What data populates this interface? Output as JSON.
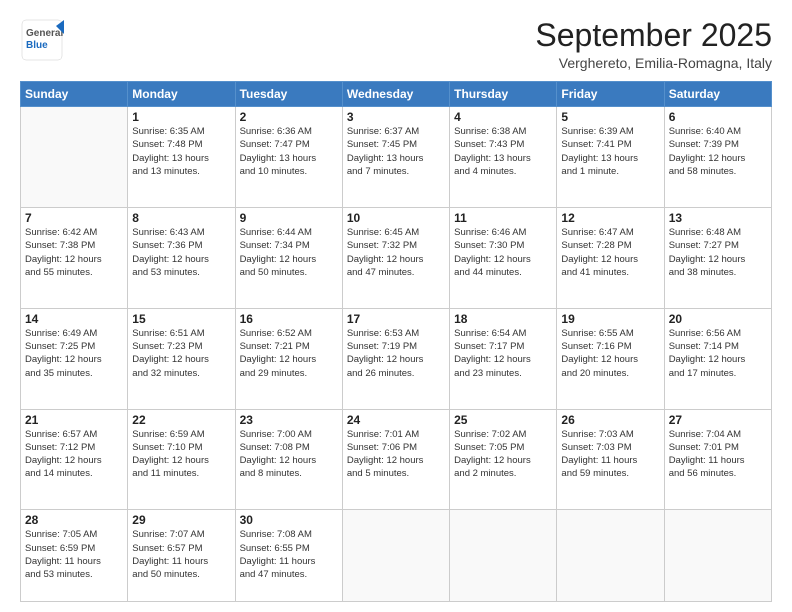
{
  "header": {
    "logo_general": "General",
    "logo_blue": "Blue",
    "month_title": "September 2025",
    "location": "Verghereto, Emilia-Romagna, Italy"
  },
  "weekdays": [
    "Sunday",
    "Monday",
    "Tuesday",
    "Wednesday",
    "Thursday",
    "Friday",
    "Saturday"
  ],
  "weeks": [
    [
      {
        "day": "",
        "text": ""
      },
      {
        "day": "1",
        "text": "Sunrise: 6:35 AM\nSunset: 7:48 PM\nDaylight: 13 hours\nand 13 minutes."
      },
      {
        "day": "2",
        "text": "Sunrise: 6:36 AM\nSunset: 7:47 PM\nDaylight: 13 hours\nand 10 minutes."
      },
      {
        "day": "3",
        "text": "Sunrise: 6:37 AM\nSunset: 7:45 PM\nDaylight: 13 hours\nand 7 minutes."
      },
      {
        "day": "4",
        "text": "Sunrise: 6:38 AM\nSunset: 7:43 PM\nDaylight: 13 hours\nand 4 minutes."
      },
      {
        "day": "5",
        "text": "Sunrise: 6:39 AM\nSunset: 7:41 PM\nDaylight: 13 hours\nand 1 minute."
      },
      {
        "day": "6",
        "text": "Sunrise: 6:40 AM\nSunset: 7:39 PM\nDaylight: 12 hours\nand 58 minutes."
      }
    ],
    [
      {
        "day": "7",
        "text": "Sunrise: 6:42 AM\nSunset: 7:38 PM\nDaylight: 12 hours\nand 55 minutes."
      },
      {
        "day": "8",
        "text": "Sunrise: 6:43 AM\nSunset: 7:36 PM\nDaylight: 12 hours\nand 53 minutes."
      },
      {
        "day": "9",
        "text": "Sunrise: 6:44 AM\nSunset: 7:34 PM\nDaylight: 12 hours\nand 50 minutes."
      },
      {
        "day": "10",
        "text": "Sunrise: 6:45 AM\nSunset: 7:32 PM\nDaylight: 12 hours\nand 47 minutes."
      },
      {
        "day": "11",
        "text": "Sunrise: 6:46 AM\nSunset: 7:30 PM\nDaylight: 12 hours\nand 44 minutes."
      },
      {
        "day": "12",
        "text": "Sunrise: 6:47 AM\nSunset: 7:28 PM\nDaylight: 12 hours\nand 41 minutes."
      },
      {
        "day": "13",
        "text": "Sunrise: 6:48 AM\nSunset: 7:27 PM\nDaylight: 12 hours\nand 38 minutes."
      }
    ],
    [
      {
        "day": "14",
        "text": "Sunrise: 6:49 AM\nSunset: 7:25 PM\nDaylight: 12 hours\nand 35 minutes."
      },
      {
        "day": "15",
        "text": "Sunrise: 6:51 AM\nSunset: 7:23 PM\nDaylight: 12 hours\nand 32 minutes."
      },
      {
        "day": "16",
        "text": "Sunrise: 6:52 AM\nSunset: 7:21 PM\nDaylight: 12 hours\nand 29 minutes."
      },
      {
        "day": "17",
        "text": "Sunrise: 6:53 AM\nSunset: 7:19 PM\nDaylight: 12 hours\nand 26 minutes."
      },
      {
        "day": "18",
        "text": "Sunrise: 6:54 AM\nSunset: 7:17 PM\nDaylight: 12 hours\nand 23 minutes."
      },
      {
        "day": "19",
        "text": "Sunrise: 6:55 AM\nSunset: 7:16 PM\nDaylight: 12 hours\nand 20 minutes."
      },
      {
        "day": "20",
        "text": "Sunrise: 6:56 AM\nSunset: 7:14 PM\nDaylight: 12 hours\nand 17 minutes."
      }
    ],
    [
      {
        "day": "21",
        "text": "Sunrise: 6:57 AM\nSunset: 7:12 PM\nDaylight: 12 hours\nand 14 minutes."
      },
      {
        "day": "22",
        "text": "Sunrise: 6:59 AM\nSunset: 7:10 PM\nDaylight: 12 hours\nand 11 minutes."
      },
      {
        "day": "23",
        "text": "Sunrise: 7:00 AM\nSunset: 7:08 PM\nDaylight: 12 hours\nand 8 minutes."
      },
      {
        "day": "24",
        "text": "Sunrise: 7:01 AM\nSunset: 7:06 PM\nDaylight: 12 hours\nand 5 minutes."
      },
      {
        "day": "25",
        "text": "Sunrise: 7:02 AM\nSunset: 7:05 PM\nDaylight: 12 hours\nand 2 minutes."
      },
      {
        "day": "26",
        "text": "Sunrise: 7:03 AM\nSunset: 7:03 PM\nDaylight: 11 hours\nand 59 minutes."
      },
      {
        "day": "27",
        "text": "Sunrise: 7:04 AM\nSunset: 7:01 PM\nDaylight: 11 hours\nand 56 minutes."
      }
    ],
    [
      {
        "day": "28",
        "text": "Sunrise: 7:05 AM\nSunset: 6:59 PM\nDaylight: 11 hours\nand 53 minutes."
      },
      {
        "day": "29",
        "text": "Sunrise: 7:07 AM\nSunset: 6:57 PM\nDaylight: 11 hours\nand 50 minutes."
      },
      {
        "day": "30",
        "text": "Sunrise: 7:08 AM\nSunset: 6:55 PM\nDaylight: 11 hours\nand 47 minutes."
      },
      {
        "day": "",
        "text": ""
      },
      {
        "day": "",
        "text": ""
      },
      {
        "day": "",
        "text": ""
      },
      {
        "day": "",
        "text": ""
      }
    ]
  ]
}
